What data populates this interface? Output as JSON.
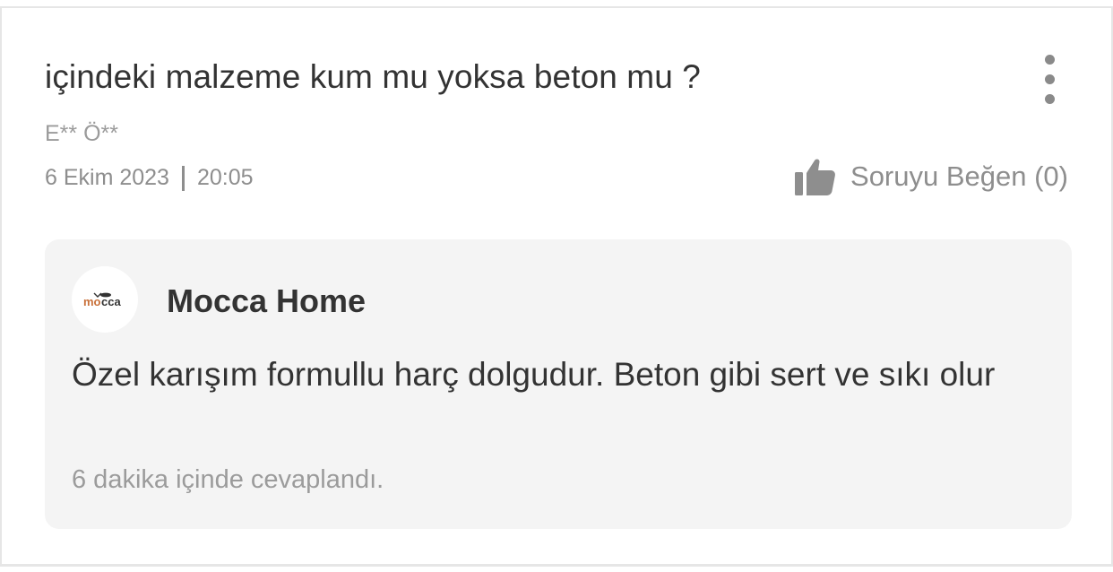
{
  "question": {
    "text": "içindeki malzeme kum mu yoksa beton mu ?",
    "asker": "E** Ö**",
    "date": "6 Ekim 2023",
    "time": "20:05",
    "like_label": "Soruyu Beğen (0)",
    "more_icon": "more-vertical-icon",
    "like_icon": "thumbs-up-icon"
  },
  "answer": {
    "seller_name": "Mocca Home",
    "seller_logo_text": "mocca",
    "text": "Özel karışım formullu harç dolgudur. Beton gibi sert ve sıkı olur",
    "answered_time": "6 dakika içinde cevaplandı."
  },
  "colors": {
    "text_primary": "#333333",
    "text_muted": "#8e8e8e",
    "answer_bg": "#f4f4f4",
    "border": "#e6e6e6",
    "logo_accent": "#c9713a"
  }
}
